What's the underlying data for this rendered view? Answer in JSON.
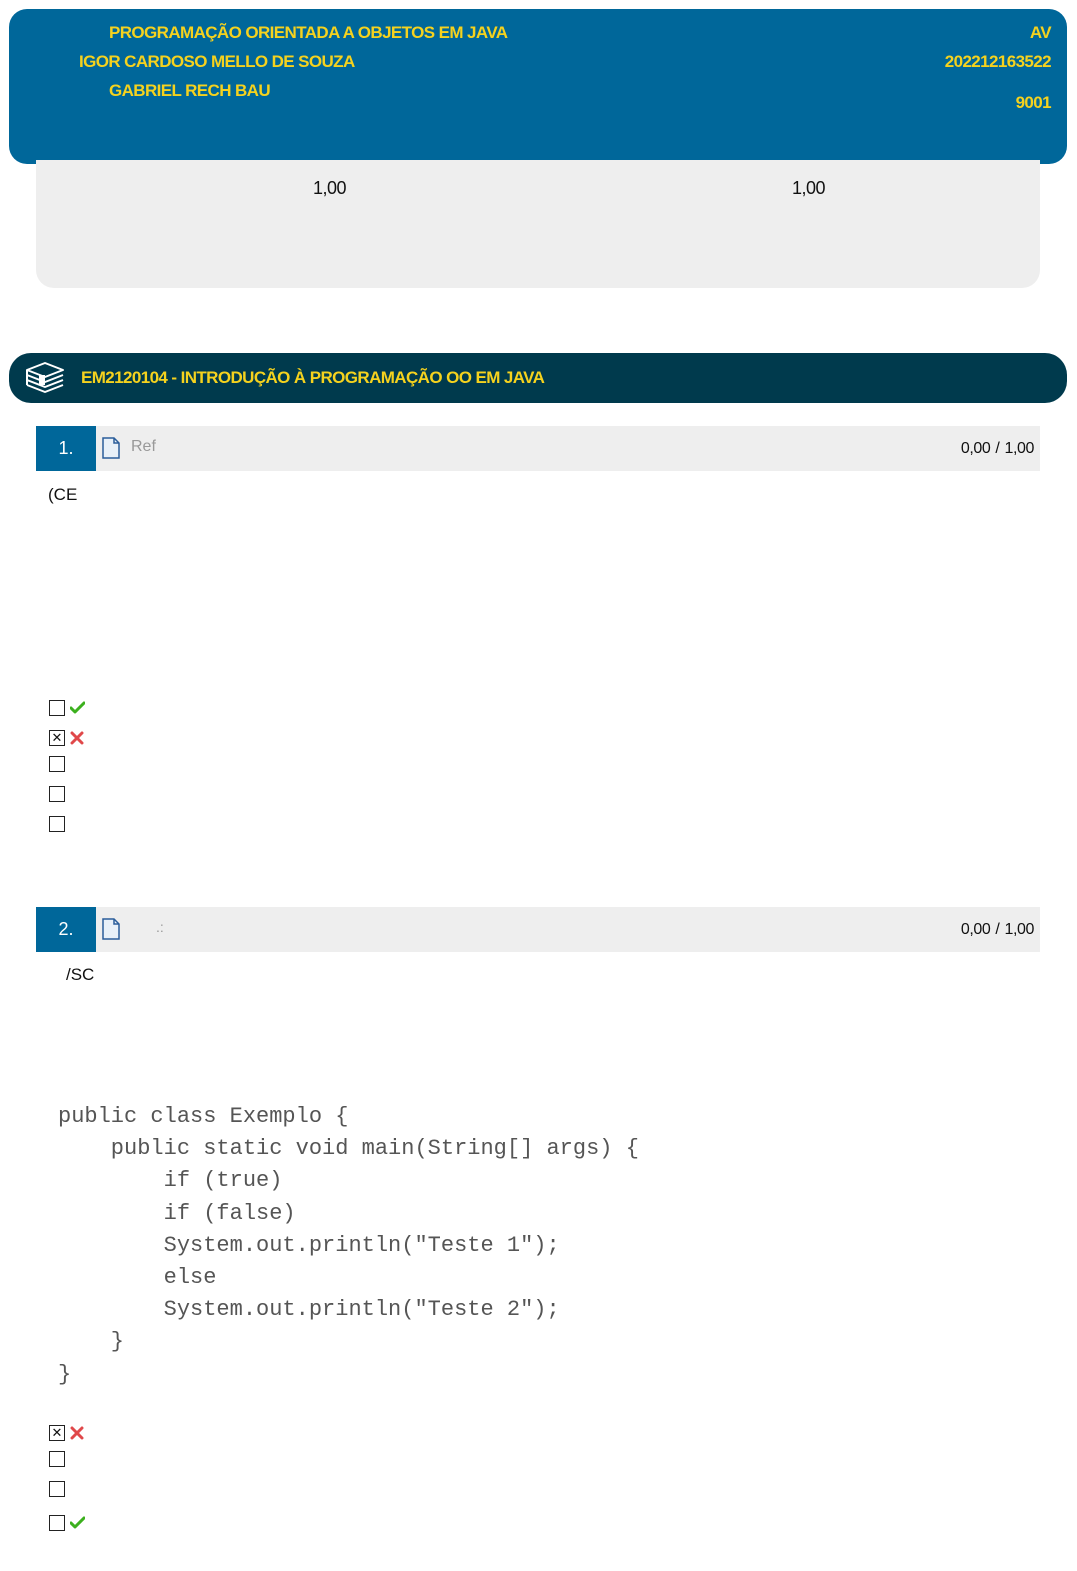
{
  "header": {
    "course_title": "PROGRAMAÇÃO ORIENTADA A OBJETOS EM JAVA",
    "student_name": "IGOR CARDOSO MELLO DE SOUZA",
    "teacher_name": "GABRIEL RECH BAU",
    "exam_type": "AV",
    "registration": "202212163522",
    "class_code": "9001"
  },
  "scores": {
    "score_left": "1,00",
    "score_right": "1,00"
  },
  "section": {
    "title": "EM2120104 - INTRODUÇÃO À PROGRAMAÇÃO OO EM JAVA",
    "icon": "books-icon"
  },
  "questions": [
    {
      "number": "1.",
      "ref_label": "Ref",
      "score": "0,00",
      "score_separator": "/",
      "score_max": "1,00",
      "text_fragment": "(CE",
      "options": [
        {
          "checked": false,
          "mark": "correct"
        },
        {
          "checked": true,
          "mark": "wrong"
        },
        {
          "checked": false,
          "mark": ""
        },
        {
          "checked": false,
          "mark": ""
        },
        {
          "checked": false,
          "mark": ""
        }
      ]
    },
    {
      "number": "2.",
      "ref_label": ".:",
      "score": "0,00",
      "score_separator": "/",
      "score_max": "1,00",
      "text_fragment": "/SC",
      "code": "public class Exemplo {\n    public static void main(String[] args) {\n        if (true)\n        if (false)\n        System.out.println(\"Teste 1\");\n        else\n        System.out.println(\"Teste 2\");\n    }\n}",
      "options": [
        {
          "checked": true,
          "mark": "wrong"
        },
        {
          "checked": false,
          "mark": ""
        },
        {
          "checked": false,
          "mark": ""
        },
        {
          "checked": false,
          "mark": "correct"
        }
      ]
    }
  ],
  "colors": {
    "header_bg": "#00679a",
    "section_bg": "#003a4d",
    "accent_text": "#f5d21e",
    "score_box_bg": "#eeeeee",
    "correct_mark": "#3cb01e",
    "wrong_mark": "#e0484a"
  }
}
